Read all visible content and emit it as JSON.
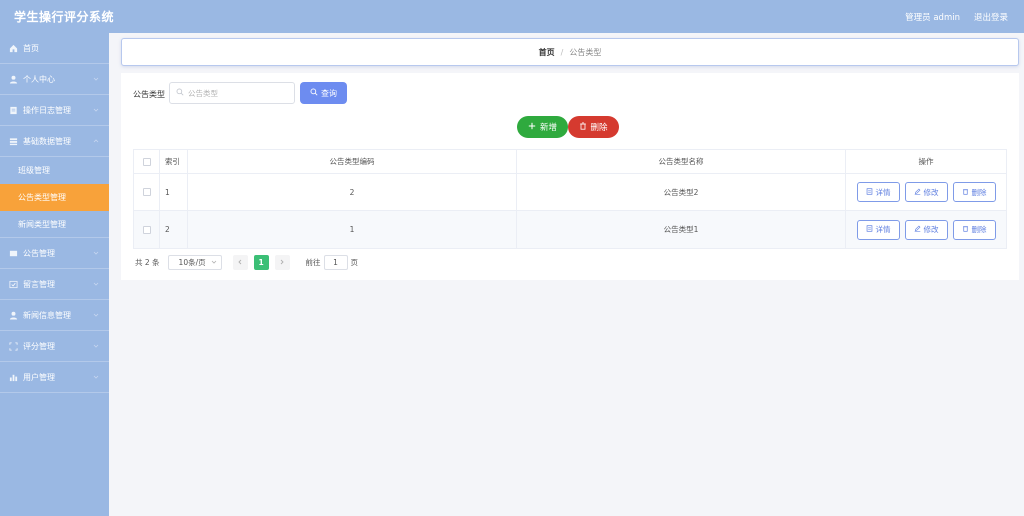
{
  "app": {
    "title": "学生操行评分系统"
  },
  "header": {
    "user_label": "管理员 admin",
    "logout_label": "退出登录"
  },
  "sidebar": {
    "items": [
      {
        "label": "首页",
        "icon": "home-icon"
      },
      {
        "label": "个人中心",
        "icon": "user-icon"
      },
      {
        "label": "操作日志管理",
        "icon": "log-icon"
      },
      {
        "label": "基础数据管理",
        "icon": "database-icon"
      },
      {
        "label": "公告管理",
        "icon": "notice-icon"
      },
      {
        "label": "留言管理",
        "icon": "message-icon"
      },
      {
        "label": "新闻信息管理",
        "icon": "news-icon"
      },
      {
        "label": "评分管理",
        "icon": "score-icon"
      },
      {
        "label": "用户管理",
        "icon": "chart-icon"
      }
    ],
    "sub_items": [
      {
        "label": "班级管理",
        "active": false
      },
      {
        "label": "公告类型管理",
        "active": true
      },
      {
        "label": "新闻类型管理",
        "active": false
      }
    ]
  },
  "breadcrumb": {
    "home": "首页",
    "separator": "/",
    "current": "公告类型"
  },
  "search": {
    "label": "公告类型",
    "placeholder": "公告类型",
    "value": "",
    "button_label": "查询"
  },
  "actions": {
    "add_label": "新增",
    "delete_label": "删除"
  },
  "table": {
    "columns": [
      "索引",
      "公告类型编码",
      "公告类型名称",
      "操作"
    ],
    "rows": [
      {
        "index": "1",
        "code": "2",
        "name": "公告类型2"
      },
      {
        "index": "2",
        "code": "1",
        "name": "公告类型1"
      }
    ],
    "row_actions": {
      "detail": "详情",
      "edit": "修改",
      "delete": "删除"
    }
  },
  "pagination": {
    "total_label": "共 2 条",
    "page_size_label": "10条/页",
    "current_page": "1",
    "goto_label": "前往",
    "goto_value": "1",
    "page_suffix": "页"
  },
  "colors": {
    "sidebar": "#9ab8e3",
    "active_item": "#f8a23a",
    "primary": "#6d8cf0",
    "success": "#2faa3e",
    "danger": "#d53a2f",
    "page_active": "#3bbf76"
  }
}
